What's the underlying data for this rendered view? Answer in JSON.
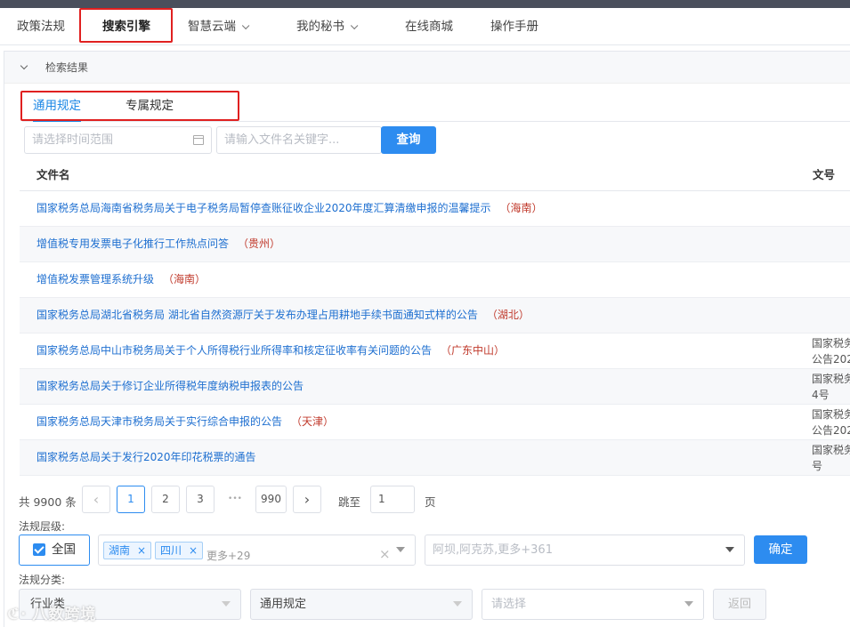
{
  "nav": {
    "items": [
      {
        "label": "政策法规"
      },
      {
        "label": "搜索引擎"
      },
      {
        "label": "智慧云端"
      },
      {
        "label": "我的秘书"
      },
      {
        "label": "在线商城"
      },
      {
        "label": "操作手册"
      }
    ]
  },
  "panel": {
    "title": "检索结果"
  },
  "tabs": [
    {
      "label": "通用规定"
    },
    {
      "label": "专属规定"
    }
  ],
  "search": {
    "date_placeholder": "请选择时间范围",
    "keyword_placeholder": "请输入文件名关键字...",
    "query_label": "查询"
  },
  "table": {
    "headers": {
      "name": "文件名",
      "number": "文号"
    },
    "rows": [
      {
        "title": "国家税务总局海南省税务局关于电子税务局暂停查账征收企业2020年度汇算清缴申报的温馨提示",
        "region": "（海南）",
        "no1": "",
        "no2": ""
      },
      {
        "title": "增值税专用发票电子化推行工作热点问答",
        "region": "（贵州）",
        "no1": "",
        "no2": ""
      },
      {
        "title": "增值税发票管理系统升级",
        "region": "（海南）",
        "no1": "",
        "no2": ""
      },
      {
        "title": "国家税务总局湖北省税务局 湖北省自然资源厅关于发布办理占用耕地手续书面通知式样的公告",
        "region": "（湖北）",
        "no1": "",
        "no2": ""
      },
      {
        "title": "国家税务总局中山市税务局关于个人所得税行业所得率和核定征收率有关问题的公告",
        "region": "（广东中山）",
        "no1": "国家税务",
        "no2": "公告202"
      },
      {
        "title": "国家税务总局关于修订企业所得税年度纳税申报表的公告",
        "region": "",
        "no1": "国家税务",
        "no2": "4号"
      },
      {
        "title": "国家税务总局天津市税务局关于实行综合申报的公告",
        "region": "（天津）",
        "no1": "国家税务",
        "no2": "公告202"
      },
      {
        "title": "国家税务总局关于发行2020年印花税票的通告",
        "region": "",
        "no1": "国家税务",
        "no2": "号"
      }
    ]
  },
  "pagination": {
    "total": "共 9900 条",
    "prev": "‹",
    "pages": [
      "1",
      "2",
      "3"
    ],
    "ellipsis": "•••",
    "last": "990",
    "next": "›",
    "jump_label": "跳至",
    "jump_value": "1",
    "page_unit": "页",
    "current": 1
  },
  "filters": {
    "level_label": "法规层级:",
    "nationwide_label": "全国",
    "nationwide_checked": true,
    "provinces": [
      "湖南",
      "四川"
    ],
    "provinces_more": "更多+29",
    "cities_placeholder": "阿坝,阿克苏,更多+361",
    "confirm_label": "确定",
    "category_label": "法规分类:",
    "category1": "行业类",
    "category2": "通用规定",
    "category3_placeholder": "请选择",
    "back_label": "返回"
  },
  "watermark": "八数跨境",
  "colors": {
    "accent": "#2d8cf0",
    "highlight_box": "#e02020",
    "link": "#1e6fd0",
    "region": "#c0392b"
  },
  "icons": [
    "chevron-down-icon",
    "calendar-icon",
    "close-icon",
    "checkbox-checked-icon"
  ]
}
